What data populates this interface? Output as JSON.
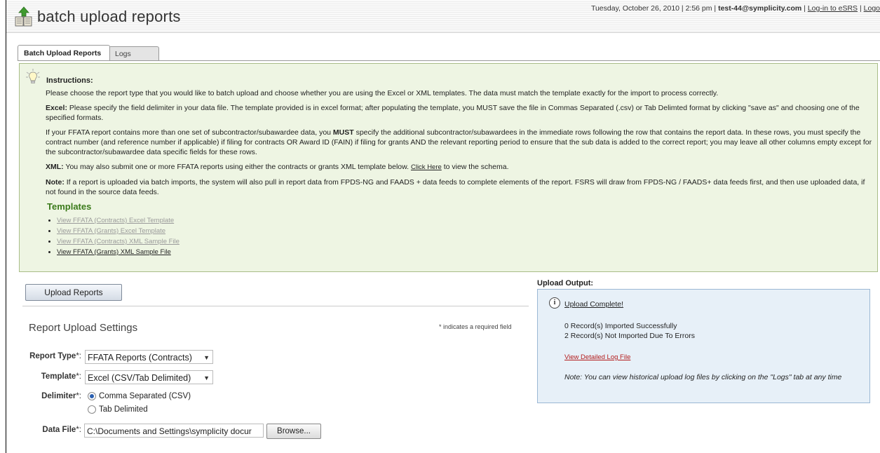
{
  "header": {
    "title": "batch upload reports",
    "date": "Tuesday, October 26, 2010 | 2:56 pm |",
    "user": "test-44@symplicity.com",
    "separator": "|",
    "esrs_link": "Log-in to eSRS",
    "logout_link": "Logo"
  },
  "tabs": [
    {
      "label": "Batch Upload Reports",
      "active": true
    },
    {
      "label": "Logs",
      "active": false
    }
  ],
  "instructions": {
    "title": "Instructions:",
    "p1": "Please choose the report type that you would like to batch upload and choose whether you are using the Excel or XML templates. The data must match the template exactly for the import to process correctly.",
    "p2_label": "Excel:",
    "p2": " Please specify the field delimiter in your data file. The template provided is in excel format; after populating the template, you MUST save the file in Commas Separated (.csv) or Tab Delimted format by clicking \"save as\" and choosing one of the specified formats.",
    "p3_a": "If your FFATA report contains more than one set of subcontractor/subawardee data, you ",
    "p3_must": "MUST",
    "p3_b": " specify the additional subcontractor/subawardees in the immediate rows following the row that contains the report data. In these rows, you must specify the contract number (and reference number if applicable) if filing for contracts OR Award ID (FAIN) if filing for grants AND the relevant reporting period to ensure that the sub data is added to the correct report; you may leave all other columns empty except for the subcontractor/subawardee data specific fields for these rows.",
    "p4_label": "XML:",
    "p4_a": " You may also submit one or more FFATA reports using either the contracts or grants XML template below. ",
    "p4_link": "Click Here",
    "p4_b": " to view the schema.",
    "p5_label": "Note:",
    "p5": " If a report is uploaded via batch imports, the system will also pull in report data from FPDS-NG and FAADS + data feeds to complete elements of the report. FSRS will draw from FPDS-NG / FAADS+ data feeds first, and then use uploaded data, if not found in the source data feeds.",
    "templates_title": "Templates",
    "templates": [
      "View FFATA (Contracts) Excel Template",
      "View FFATA (Grants) Excel Template",
      "View FFATA (Contracts) XML Sample File",
      "View FFATA (Grants) XML Sample File"
    ]
  },
  "form": {
    "upload_button": "Upload Reports",
    "settings_title": "Report Upload Settings",
    "required_note": "* indicates a required field",
    "report_type_label": "Report Type",
    "report_type_value": "FFATA Reports (Contracts)",
    "template_label": "Template",
    "template_value": "Excel (CSV/Tab Delimited)",
    "delimiter_label": "Delimiter",
    "delimiter_options": [
      "Comma Separated (CSV)",
      "Tab Delimited"
    ],
    "data_file_label": "Data File",
    "data_file_value": "C:\\Documents and Settings\\symplicity docur",
    "browse_button": "Browse...",
    "required_mark": "*:"
  },
  "output": {
    "label": "Upload Output:",
    "complete": "Upload Complete!",
    "line1": "0 Record(s) Imported Successfully",
    "line2": "2 Record(s) Not Imported Due To Errors",
    "log_link": "View Detailed Log File",
    "note": "Note: You can view historical upload log files by clicking on the \"Logs\" tab at any time"
  },
  "colors": {
    "instructions_bg": "#eef5e3",
    "output_bg": "#e7f0f8",
    "templates_title": "#3a7a1a",
    "log_link": "#b31b1b"
  },
  "icons": [
    "upload-reports-icon",
    "lightbulb-icon",
    "info-icon",
    "dropdown-arrow-icon",
    "radio-icon"
  ]
}
